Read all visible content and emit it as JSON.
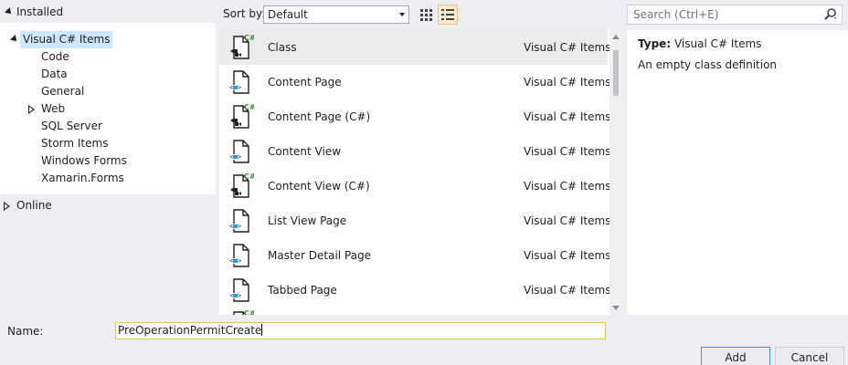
{
  "tree": {
    "installed_label": "Installed",
    "root_label": "Visual C# Items",
    "children": [
      "Code",
      "Data",
      "General",
      "Web",
      "SQL Server",
      "Storm Items",
      "Windows Forms",
      "Xamarin.Forms"
    ],
    "online_label": "Online"
  },
  "toolbar": {
    "sort_label": "Sort by:",
    "sort_value": "Default",
    "search_placeholder": "Search (Ctrl+E)"
  },
  "templates": [
    {
      "name": "Class",
      "category": "Visual C# Items",
      "icon": "csharp-class-icon",
      "selected": true
    },
    {
      "name": "Content Page",
      "category": "Visual C# Items",
      "icon": "xaml-page-icon"
    },
    {
      "name": "Content Page (C#)",
      "category": "Visual C# Items",
      "icon": "csharp-page-icon"
    },
    {
      "name": "Content View",
      "category": "Visual C# Items",
      "icon": "xaml-page-icon"
    },
    {
      "name": "Content View (C#)",
      "category": "Visual C# Items",
      "icon": "csharp-page-icon"
    },
    {
      "name": "List View Page",
      "category": "Visual C# Items",
      "icon": "xaml-page-icon"
    },
    {
      "name": "Master Detail Page",
      "category": "Visual C# Items",
      "icon": "xaml-page-icon"
    },
    {
      "name": "Tabbed Page",
      "category": "Visual C# Items",
      "icon": "xaml-page-icon"
    }
  ],
  "details": {
    "type_key": "Type:",
    "type_value": "Visual C# Items",
    "description": "An empty class definition"
  },
  "name_field": {
    "label": "Name:",
    "value": "PreOperationPermitCreate"
  },
  "buttons": {
    "add": "Add",
    "cancel": "Cancel"
  },
  "colors": {
    "background": "#eeeef2",
    "selection": "#cce8ff",
    "accent_green": "#388a34",
    "accent_blue": "#1ba1e2",
    "focus_border": "#e5c365"
  }
}
